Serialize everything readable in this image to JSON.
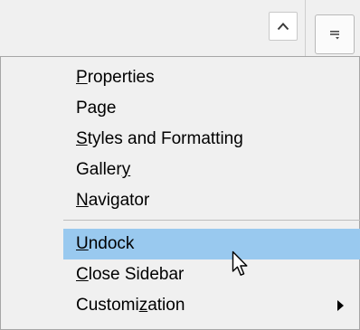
{
  "toolbar": {
    "collapse_icon": "chevron-up-icon",
    "deck_icon": "sidebar-menu-icon"
  },
  "menu": {
    "items": [
      {
        "label": "Properties",
        "mnemonic": "P"
      },
      {
        "label": "Page",
        "mnemonic": "g"
      },
      {
        "label": "Styles and Formatting",
        "mnemonic": "S"
      },
      {
        "label": "Gallery",
        "mnemonic": "y"
      },
      {
        "label": "Navigator",
        "mnemonic": "N"
      },
      {
        "label": "Undock",
        "mnemonic": "U",
        "highlighted": true
      },
      {
        "label": "Close Sidebar",
        "mnemonic": "C"
      },
      {
        "label": "Customization",
        "mnemonic": "z",
        "has_submenu": true
      }
    ]
  },
  "colors": {
    "highlight": "#99c9ef",
    "background": "#f0f0f0",
    "border": "#a6a6a6"
  }
}
